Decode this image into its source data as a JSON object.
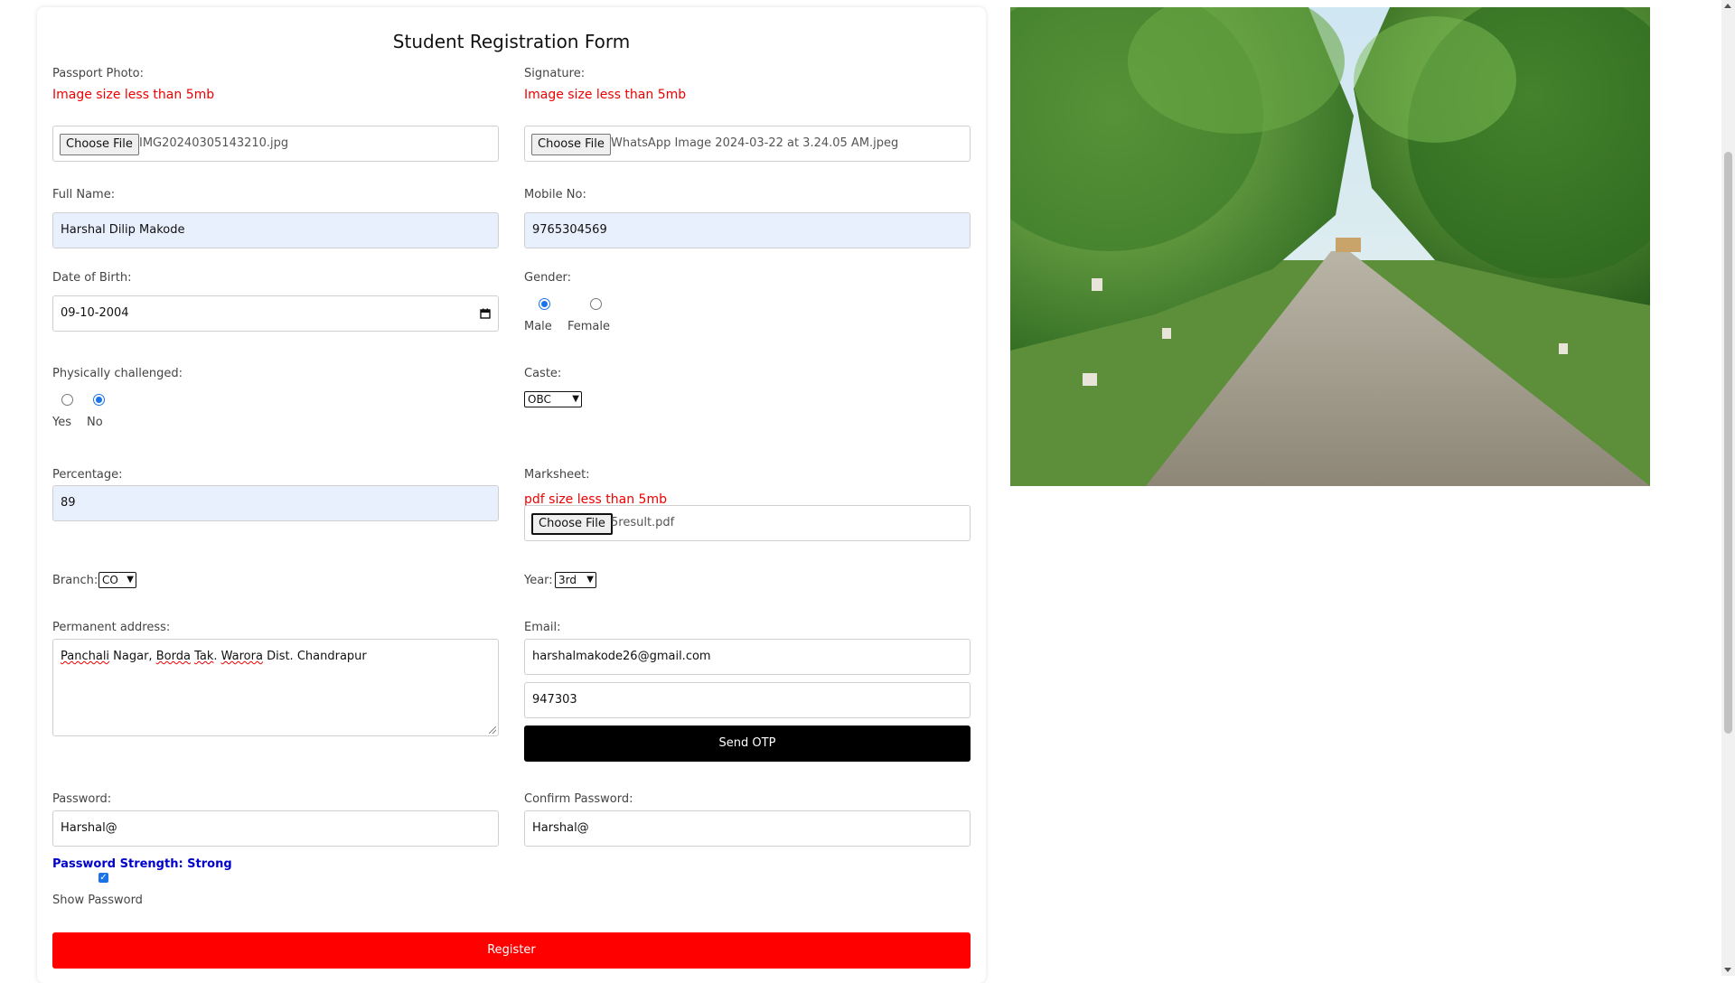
{
  "form": {
    "title": "Student Registration Form",
    "passport_photo": {
      "label": "Passport Photo:",
      "hint": "Image size less than 5mb",
      "button": "Choose File",
      "file": "IMG20240305143210.jpg"
    },
    "signature": {
      "label": "Signature:",
      "hint": "Image size less than 5mb",
      "button": "Choose File",
      "file": "WhatsApp Image 2024-03-22 at 3.24.05 AM.jpeg"
    },
    "full_name": {
      "label": "Full Name:",
      "value": "Harshal Dilip Makode"
    },
    "mobile": {
      "label": "Mobile No:",
      "value": "9765304569"
    },
    "dob": {
      "label": "Date of Birth:",
      "value": "09-10-2004"
    },
    "gender": {
      "label": "Gender:",
      "options": [
        "Male",
        "Female"
      ],
      "selected": "Male"
    },
    "physically_challenged": {
      "label": "Physically challenged:",
      "options": [
        "Yes",
        "No"
      ],
      "selected": "No"
    },
    "caste": {
      "label": "Caste:",
      "selected": "OBC"
    },
    "percentage": {
      "label": "Percentage:",
      "value": "89"
    },
    "marksheet": {
      "label": "Marksheet:",
      "hint": "pdf size less than 5mb",
      "button": "Choose File",
      "file": "5result.pdf"
    },
    "branch": {
      "label": "Branch:",
      "selected": "CO"
    },
    "year": {
      "label": "Year:",
      "selected": "3rd"
    },
    "address": {
      "label": "Permanent address:",
      "value_parts": [
        "Panchali",
        " Nagar, ",
        "Borda",
        " ",
        "Tak",
        ". ",
        "Warora",
        " Dist. Chandrapur"
      ]
    },
    "email": {
      "label": "Email:",
      "value": "harshalmakode26@gmail.com"
    },
    "otp": {
      "value": "947303",
      "button": "Send OTP"
    },
    "password": {
      "label": "Password:",
      "value": "Harshal@"
    },
    "confirm_password": {
      "label": "Confirm Password:",
      "value": "Harshal@"
    },
    "strength": "Password Strength: Strong",
    "show_password": {
      "label": "Show Password",
      "checked": true
    },
    "register_button": "Register"
  },
  "colors": {
    "error": "#ee0000",
    "strength": "#0000cc",
    "register": "#ff0000",
    "send_otp": "#000000",
    "autofill": "#e8f0fe"
  }
}
